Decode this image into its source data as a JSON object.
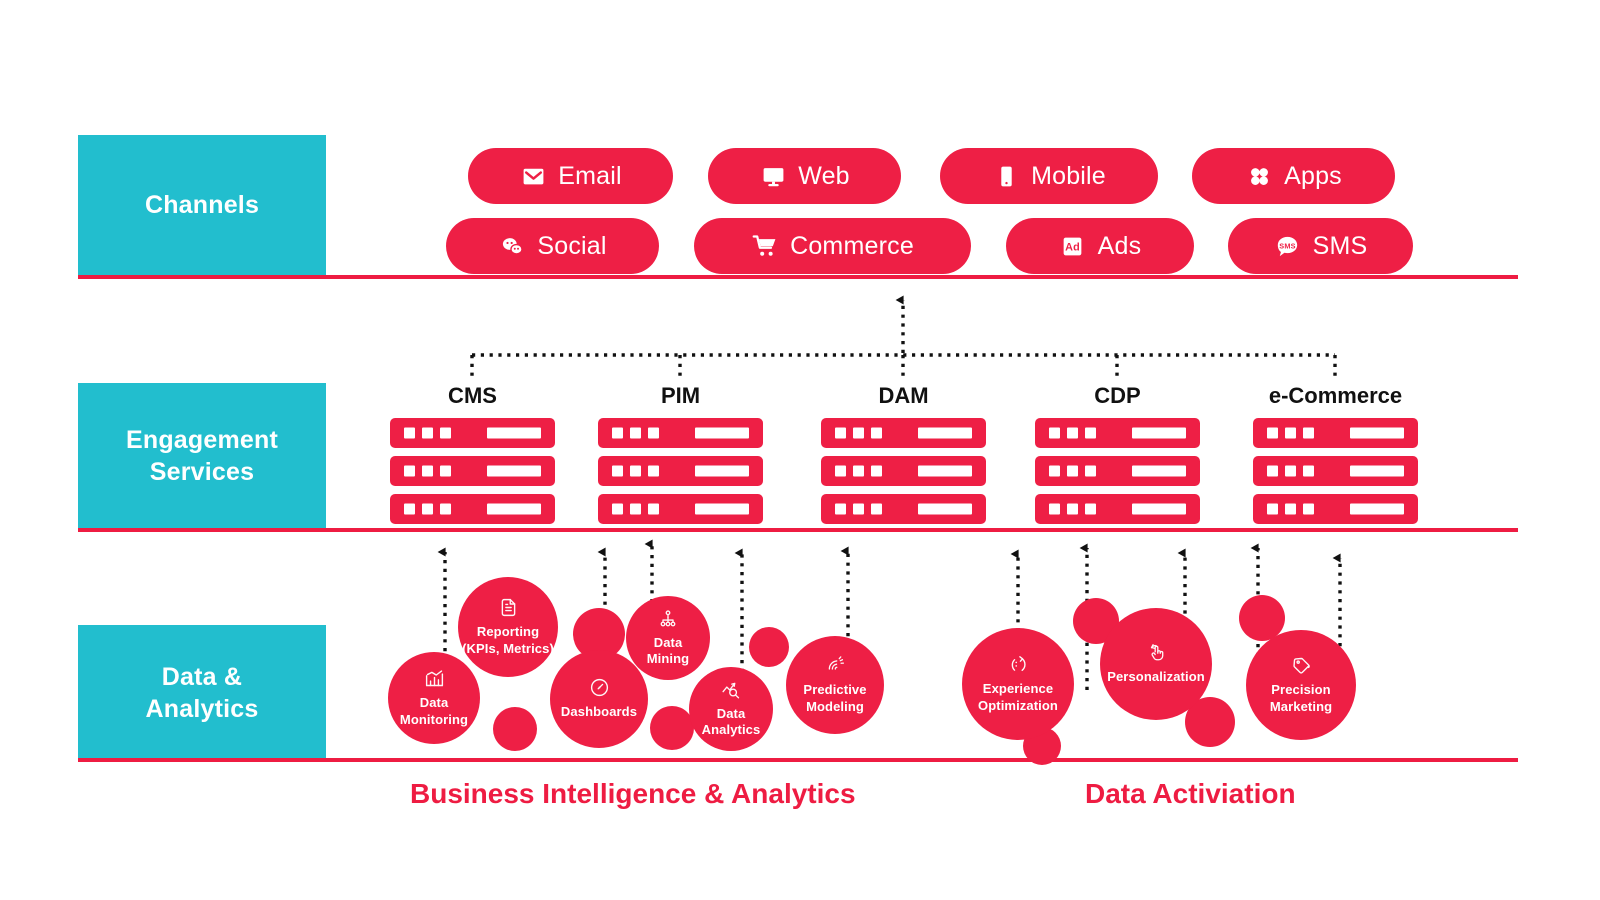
{
  "meta": {
    "colors": {
      "teal": "#22BECE",
      "red": "#EE1F45",
      "rule_red": "#EE1C42",
      "white": "#FFFFFF",
      "black": "#111111",
      "connector": "#1A1A1A"
    }
  },
  "bands": [
    {
      "id": "channels",
      "label": "Channels"
    },
    {
      "id": "engagement",
      "label": "Engagement\nServices"
    },
    {
      "id": "data",
      "label": "Data &\nAnalytics"
    }
  ],
  "channels": {
    "row1": [
      {
        "label": "Email",
        "icon": "envelope-icon"
      },
      {
        "label": "Web",
        "icon": "monitor-icon"
      },
      {
        "label": "Mobile",
        "icon": "smartphone-icon"
      },
      {
        "label": "Apps",
        "icon": "apps-grid-icon"
      }
    ],
    "row2": [
      {
        "label": "Social",
        "icon": "chat-bubbles-icon"
      },
      {
        "label": "Commerce",
        "icon": "shopping-cart-icon"
      },
      {
        "label": "Ads",
        "icon": "ad-badge-icon"
      },
      {
        "label": "SMS",
        "icon": "sms-bubble-icon"
      }
    ]
  },
  "engagement_services": [
    {
      "label": "CMS",
      "racks": 3
    },
    {
      "label": "PIM",
      "racks": 3
    },
    {
      "label": "DAM",
      "racks": 3
    },
    {
      "label": "CDP",
      "racks": 3
    },
    {
      "label": "e-Commerce",
      "racks": 3
    }
  ],
  "data_analytics": {
    "bubbles": [
      {
        "label": "Data\nMonitoring",
        "icon": "bar-chart-icon",
        "size": 92,
        "font": 15
      },
      {
        "label": "Reporting\n(KPIs, Metrics)",
        "icon": "document-icon",
        "size": 100,
        "font": 15
      },
      {
        "label": "Dashboards",
        "icon": "gauge-icon",
        "size": 98,
        "font": 15
      },
      {
        "label": "Data\nMining",
        "icon": "hierarchy-icon",
        "size": 84,
        "font": 15
      },
      {
        "label": "Data\nAnalytics",
        "icon": "chart-search-icon",
        "size": 84,
        "font": 15
      },
      {
        "label": "Predictive\nModeling",
        "icon": "signal-waves-icon",
        "size": 98,
        "font": 15
      },
      {
        "label": "Experience\nOptimization",
        "icon": "cursor-arrow-icon",
        "size": 110,
        "font": 15
      },
      {
        "label": "Personalization",
        "icon": "hand-tap-icon",
        "size": 110,
        "font": 15
      },
      {
        "label": "Precision\nMarketing",
        "icon": "tag-icon",
        "size": 108,
        "font": 15
      }
    ],
    "decorative_circle_count": 9
  },
  "captions": [
    {
      "label": "Business Intelligence & Analytics"
    },
    {
      "label": "Data Activiation"
    }
  ]
}
